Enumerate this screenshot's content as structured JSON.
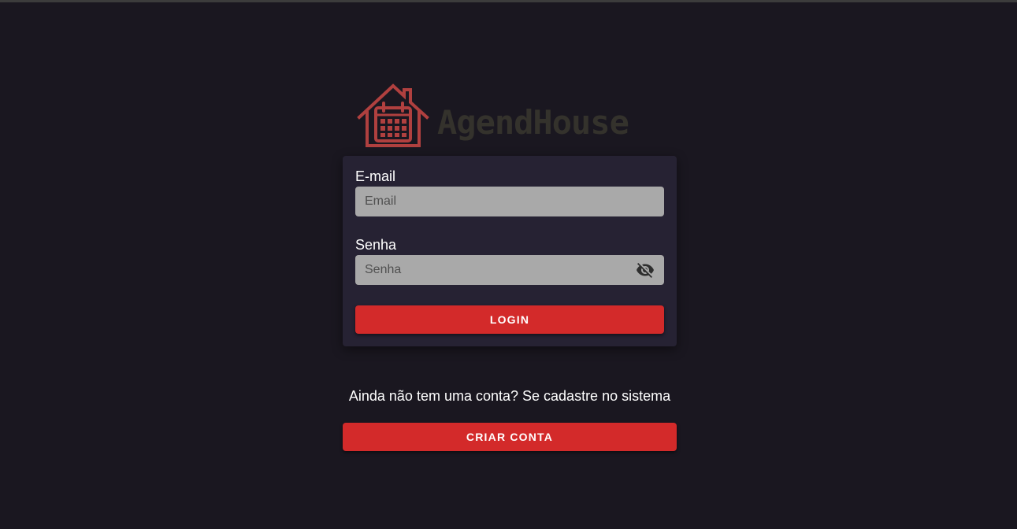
{
  "brand": {
    "name": "AgendHouse",
    "icon": "house-calendar-icon",
    "icon_color": "#b0403f",
    "text_color": "#34322c"
  },
  "login_form": {
    "email": {
      "label": "E-mail",
      "placeholder": "Email",
      "value": ""
    },
    "password": {
      "label": "Senha",
      "placeholder": "Senha",
      "value": "",
      "toggle_icon": "eye-off-icon"
    },
    "login_button_label": "LOGIN"
  },
  "signup": {
    "prompt": "Ainda não tem uma conta? Se cadastre no sistema",
    "button_label": "CRIAR CONTA"
  },
  "colors": {
    "background": "#1a1720",
    "card": "#262233",
    "input": "#a9a9a9",
    "accent": "#d32a2a"
  }
}
